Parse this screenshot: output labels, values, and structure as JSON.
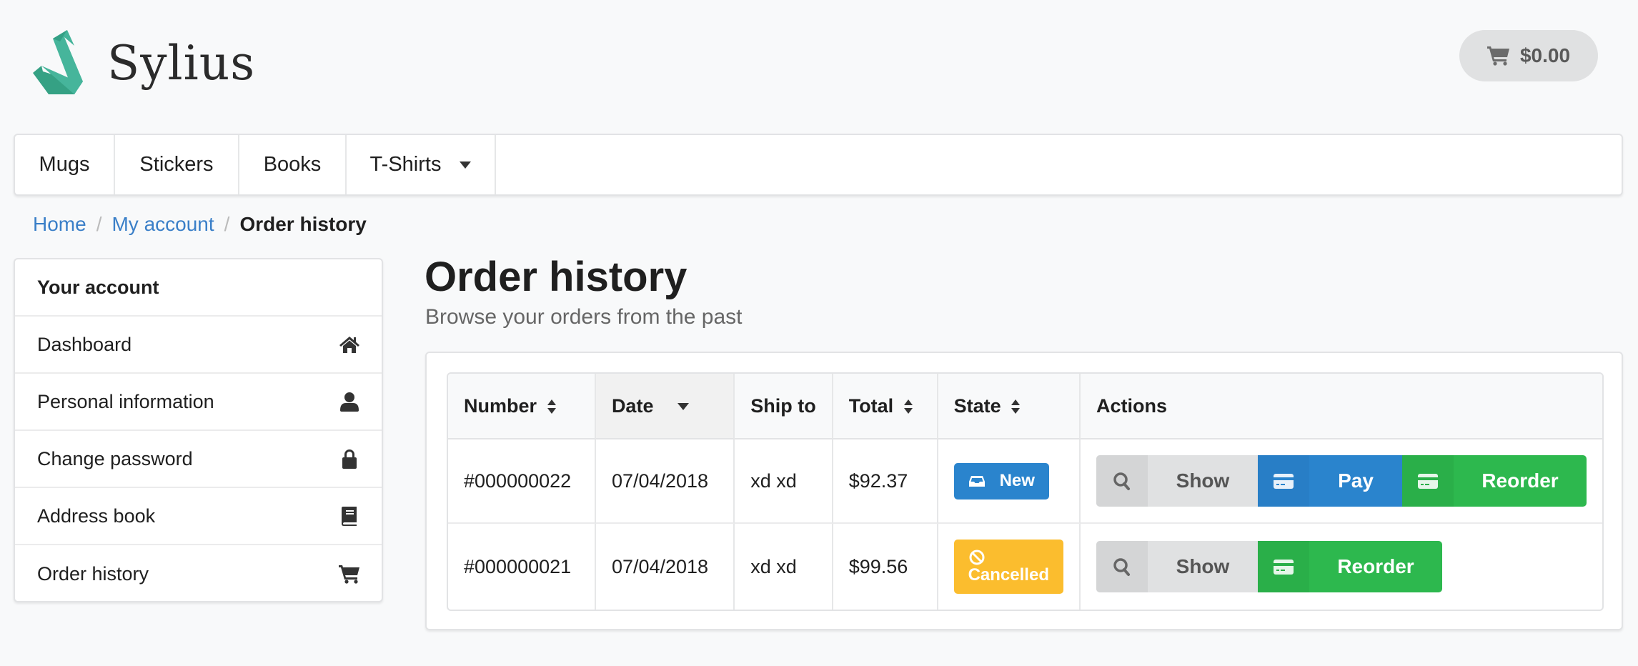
{
  "header": {
    "brand": "Sylius",
    "cart_total": "$0.00"
  },
  "nav": {
    "items": [
      {
        "label": "Mugs",
        "has_dropdown": false
      },
      {
        "label": "Stickers",
        "has_dropdown": false
      },
      {
        "label": "Books",
        "has_dropdown": false
      },
      {
        "label": "T-Shirts",
        "has_dropdown": true
      }
    ]
  },
  "breadcrumb": {
    "items": [
      {
        "label": "Home",
        "link": true
      },
      {
        "label": "My account",
        "link": true
      },
      {
        "label": "Order history",
        "link": false
      }
    ],
    "separator": "/"
  },
  "sidebar": {
    "header": "Your account",
    "items": [
      {
        "label": "Dashboard",
        "icon": "home-icon"
      },
      {
        "label": "Personal information",
        "icon": "user-icon"
      },
      {
        "label": "Change password",
        "icon": "lock-icon"
      },
      {
        "label": "Address book",
        "icon": "book-icon"
      },
      {
        "label": "Order history",
        "icon": "cart-icon"
      }
    ]
  },
  "main": {
    "title": "Order history",
    "subtitle": "Browse your orders from the past",
    "table": {
      "columns": [
        {
          "label": "Number",
          "sort": "sortable"
        },
        {
          "label": "Date",
          "sort": "descending"
        },
        {
          "label": "Ship to",
          "sort": "none"
        },
        {
          "label": "Total",
          "sort": "sortable"
        },
        {
          "label": "State",
          "sort": "sortable"
        },
        {
          "label": "Actions",
          "sort": "none"
        }
      ],
      "rows": [
        {
          "number": "#000000022",
          "date": "07/04/2018",
          "ship_to": "xd xd",
          "total": "$92.37",
          "state": {
            "label": "New",
            "icon": "inbox-icon",
            "color": "#2a84cd"
          },
          "actions": [
            {
              "label": "Show",
              "icon": "search-icon"
            },
            {
              "label": "Pay",
              "icon": "credit-card-icon"
            },
            {
              "label": "Reorder",
              "icon": "credit-card-icon"
            }
          ]
        },
        {
          "number": "#000000021",
          "date": "07/04/2018",
          "ship_to": "xd xd",
          "total": "$99.56",
          "state": {
            "label": "Cancelled",
            "icon": "ban-icon",
            "color": "#fbbd2e"
          },
          "actions": [
            {
              "label": "Show",
              "icon": "search-icon"
            },
            {
              "label": "Reorder",
              "icon": "credit-card-icon"
            }
          ]
        }
      ]
    }
  },
  "colors": {
    "background": "#f8f9fa",
    "brand_teal": "#45b39c",
    "link_blue": "#3a7fc8",
    "primary_blue": "#2a84cd",
    "success_green": "#2db84e",
    "warning_yellow": "#fbbd2e",
    "button_grey": "#e0e1e2"
  }
}
